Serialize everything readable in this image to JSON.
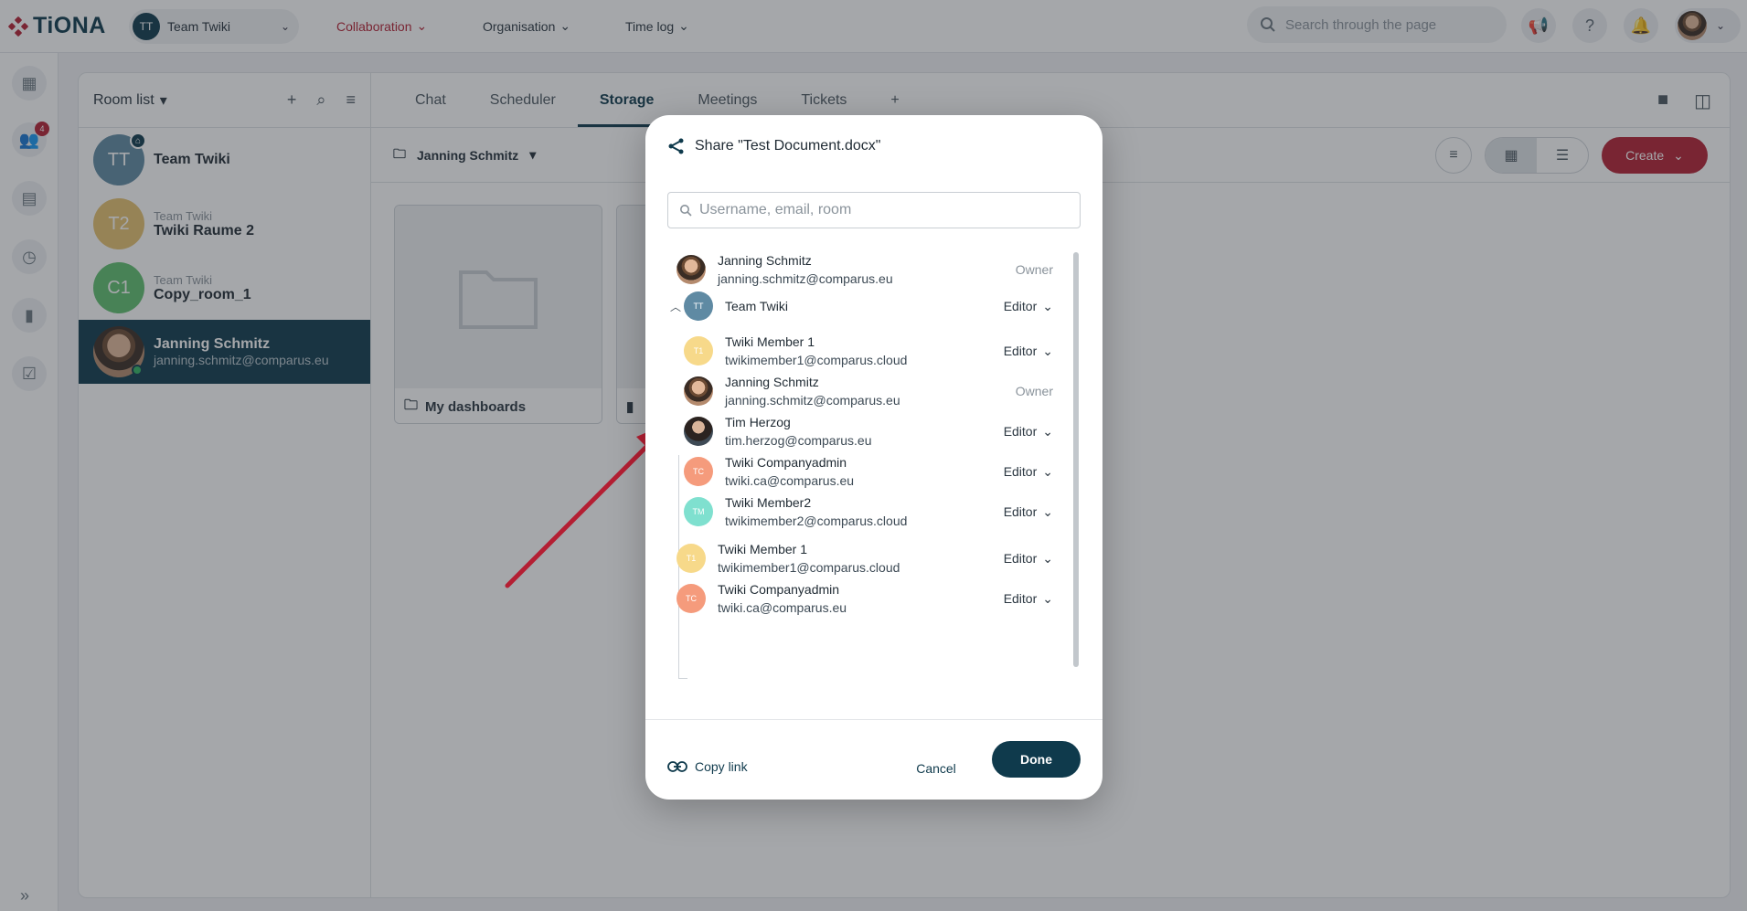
{
  "app": {
    "logo": "TiONA"
  },
  "topbar": {
    "team": {
      "initials": "TT",
      "name": "Team Twiki"
    },
    "nav": [
      {
        "label": "Collaboration",
        "active": true
      },
      {
        "label": "Organisation",
        "active": false
      },
      {
        "label": "Time log",
        "active": false
      }
    ],
    "search_placeholder": "Search through the page"
  },
  "rail": {
    "badge_count": "4"
  },
  "room_panel": {
    "title": "Room list",
    "rooms": [
      {
        "initials": "TT",
        "subtitle": "",
        "name": "Team Twiki",
        "color": "#5f8aa3"
      },
      {
        "initials": "T2",
        "subtitle": "Team Twiki",
        "name": "Twiki Raume 2",
        "color": "#e6c16f"
      },
      {
        "initials": "C1",
        "subtitle": "Team Twiki",
        "name": "Copy_room_1",
        "color": "#5fbf6e"
      },
      {
        "initials": "",
        "subtitle": "",
        "name": "Janning Schmitz",
        "email": "janning.schmitz@comparus.eu"
      }
    ]
  },
  "content": {
    "tabs": [
      "Chat",
      "Scheduler",
      "Storage",
      "Meetings",
      "Tickets"
    ],
    "active_tab": "Storage",
    "breadcrumb": "Janning Schmitz",
    "create_label": "Create",
    "tiles": [
      {
        "name": "My dashboards"
      }
    ]
  },
  "dialog": {
    "title": "Share \"Test Document.docx\"",
    "search_placeholder": "Username, email, room",
    "entries": [
      {
        "name": "Janning Schmitz",
        "email": "janning.schmitz@comparus.eu",
        "role": "Owner",
        "avatar": "photo"
      },
      {
        "name": "Team Twiki",
        "email": "",
        "role": "Editor",
        "avatar": "TT",
        "color": "#5f8aa3"
      },
      {
        "name": "Twiki Member 1",
        "email": "twikimember1@comparus.cloud",
        "role": "Editor",
        "avatar": "T1",
        "color": "#f7d98a"
      },
      {
        "name": "Janning Schmitz",
        "email": "janning.schmitz@comparus.eu",
        "role": "Owner",
        "avatar": "photo"
      },
      {
        "name": "Tim Herzog",
        "email": "tim.herzog@comparus.eu",
        "role": "Editor",
        "avatar": "photo2"
      },
      {
        "name": "Twiki Companyadmin",
        "email": "twiki.ca@comparus.eu",
        "role": "Editor",
        "avatar": "TC",
        "color": "#f59b7c"
      },
      {
        "name": "Twiki Member2",
        "email": "twikimember2@comparus.cloud",
        "role": "Editor",
        "avatar": "TM",
        "color": "#7fe0cf"
      },
      {
        "name": "Twiki Member 1",
        "email": "twikimember1@comparus.cloud",
        "role": "Editor",
        "avatar": "T1",
        "color": "#f7d98a"
      },
      {
        "name": "Twiki Companyadmin",
        "email": "twiki.ca@comparus.eu",
        "role": "Editor",
        "avatar": "TC",
        "color": "#f59b7c"
      }
    ],
    "copy_link_label": "Copy link",
    "cancel_label": "Cancel",
    "done_label": "Done"
  },
  "colors": {
    "brand": "#0f3a4c",
    "accent": "#b41f33"
  }
}
